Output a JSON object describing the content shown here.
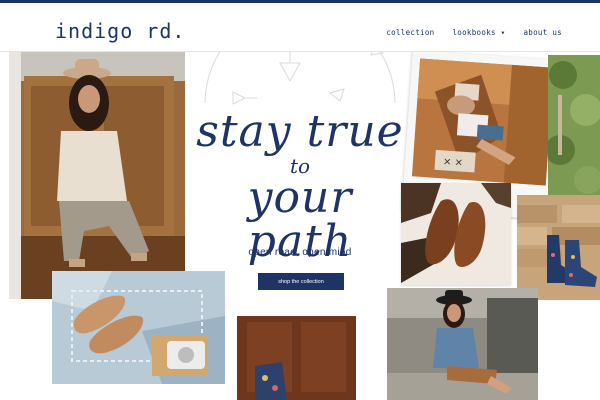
{
  "header": {
    "logo": "indigo rd.",
    "nav": [
      {
        "label": "collection"
      },
      {
        "label": "lookbooks ▾"
      },
      {
        "label": "about us"
      }
    ]
  },
  "hero": {
    "line1": "stay true",
    "line2": "to",
    "line3": "your path",
    "tagline": "open road, open mind",
    "cta": "shop the collection"
  },
  "colors": {
    "accent": "#1e3466",
    "background": "#ffffff"
  }
}
